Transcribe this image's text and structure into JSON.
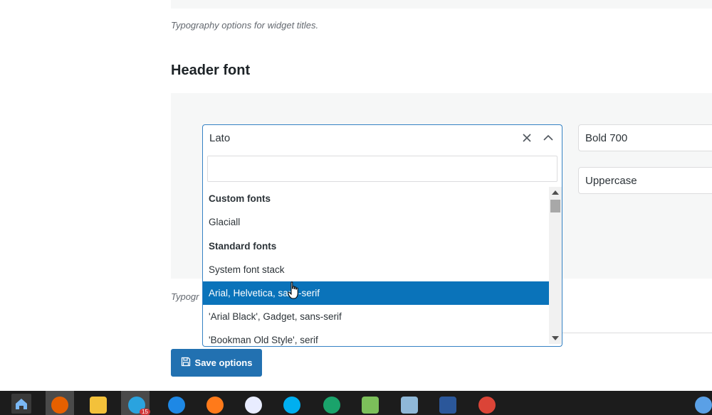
{
  "widget_titles_help": "Typography options for widget titles.",
  "header_font": {
    "heading": "Header font",
    "family_select": {
      "value": "Lato",
      "search_value": "",
      "options": [
        {
          "label": "Custom fonts",
          "group": true
        },
        {
          "label": "Glaciall",
          "group": false
        },
        {
          "label": "Standard fonts",
          "group": true
        },
        {
          "label": "System font stack",
          "group": false
        },
        {
          "label": "Arial, Helvetica, sans-serif",
          "group": false,
          "selected": true
        },
        {
          "label": "'Arial Black', Gadget, sans-serif",
          "group": false
        },
        {
          "label": "'Bookman Old Style', serif",
          "group": false
        }
      ]
    },
    "weight_value": "Bold 700",
    "transform_value": "Uppercase",
    "help_text_partial": "Typogr"
  },
  "save_button": {
    "label": "Save options"
  },
  "colors": {
    "primary": "#2271b1",
    "highlight": "#0a73ba",
    "focus_border": "#3582c4",
    "panel_bg": "#f6f7f7",
    "taskbar_bg": "#1c1c1c"
  },
  "taskbar": {
    "telegram_badge": "15",
    "icons": [
      "home-icon",
      "firefox-icon",
      "file-explorer-icon",
      "telegram-icon",
      "app-icon",
      "brave-icon",
      "app-icon-2",
      "skype-icon",
      "edge-icon",
      "notepad-icon",
      "app-icon-3",
      "word-icon",
      "chrome-icon",
      "onedrive-icon"
    ]
  }
}
